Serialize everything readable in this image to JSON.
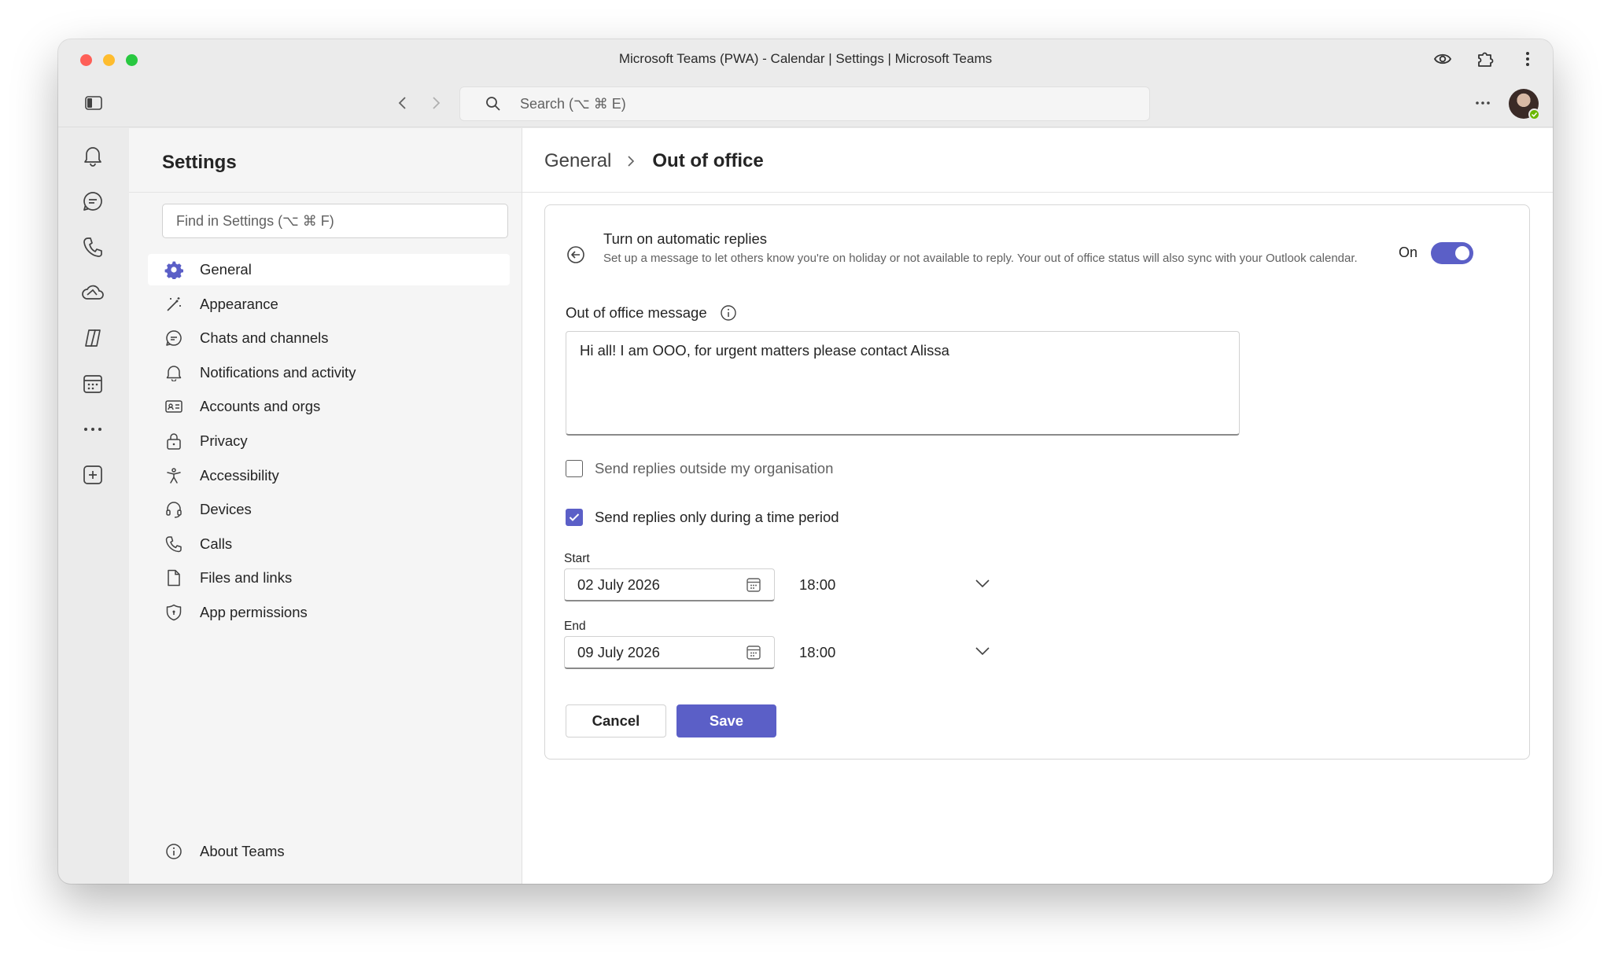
{
  "window": {
    "title": "Microsoft Teams (PWA) - Calendar | Settings | Microsoft Teams",
    "toolbar_icons": [
      "eye-icon",
      "extension-icon",
      "kebab-menu-icon"
    ]
  },
  "appbar": {
    "search_placeholder": "Search (⌥ ⌘ E)",
    "more_icon": "ellipsis-icon",
    "presence": "available"
  },
  "rail": {
    "items": [
      "bell-icon",
      "chat-icon",
      "phone-icon",
      "cloud-icon",
      "copilot-icon",
      "calendar-icon",
      "ellipsis-icon",
      "add-app-icon"
    ]
  },
  "settings": {
    "title": "Settings",
    "find_placeholder": "Find in Settings (⌥ ⌘ F)",
    "menu": [
      {
        "label": "General",
        "icon": "gear-icon",
        "active": true
      },
      {
        "label": "Appearance",
        "icon": "wand-icon"
      },
      {
        "label": "Chats and channels",
        "icon": "chat-icon"
      },
      {
        "label": "Notifications and activity",
        "icon": "bell-icon"
      },
      {
        "label": "Accounts and orgs",
        "icon": "id-card-icon"
      },
      {
        "label": "Privacy",
        "icon": "lock-icon"
      },
      {
        "label": "Accessibility",
        "icon": "accessibility-icon"
      },
      {
        "label": "Devices",
        "icon": "headset-icon"
      },
      {
        "label": "Calls",
        "icon": "phone-icon"
      },
      {
        "label": "Files and links",
        "icon": "file-icon"
      },
      {
        "label": "App permissions",
        "icon": "shield-icon"
      }
    ],
    "about": "About Teams"
  },
  "main": {
    "breadcrumb": {
      "parent": "General",
      "current": "Out of office"
    },
    "auto_replies": {
      "title": "Turn on automatic replies",
      "description": "Set up a message to let others know you're on holiday or not available to reply. Your out of office status will also sync with your Outlook calendar.",
      "toggle_label": "On",
      "toggle_on": true
    },
    "message": {
      "label": "Out of office message",
      "value": "Hi all! I am OOO, for urgent matters please contact Alissa"
    },
    "options": {
      "outside_org": {
        "label": "Send replies outside my organisation",
        "checked": false
      },
      "time_period": {
        "label": "Send replies only during a time period",
        "checked": true
      }
    },
    "start": {
      "label": "Start",
      "date": "02 July 2026",
      "time": "18:00"
    },
    "end": {
      "label": "End",
      "date": "09 July 2026",
      "time": "18:00"
    },
    "buttons": {
      "cancel": "Cancel",
      "save": "Save"
    },
    "accent_color": "#5b5fc7"
  }
}
